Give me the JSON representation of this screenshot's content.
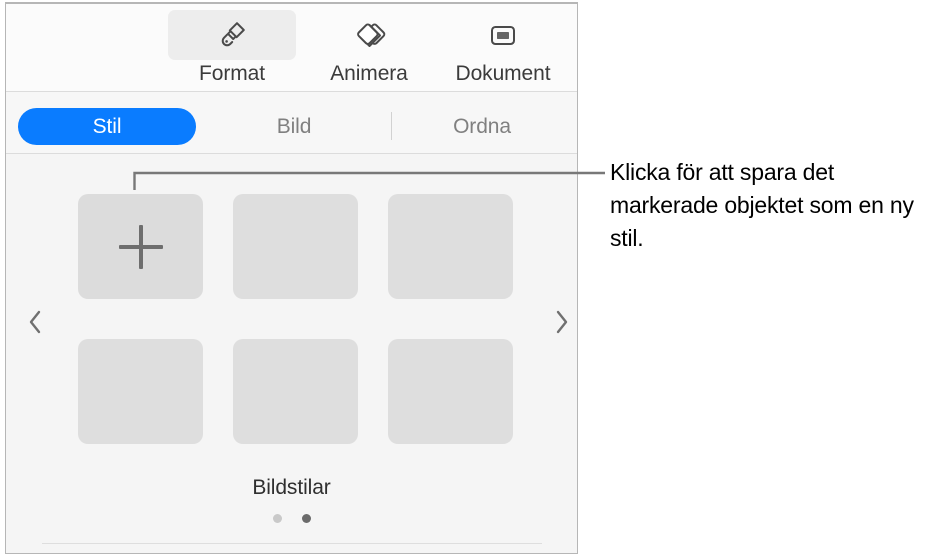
{
  "inspector": {
    "toolbar": {
      "buttons": [
        {
          "label": "Format",
          "icon": "paintbrush-icon",
          "selected": true
        },
        {
          "label": "Animera",
          "icon": "overlapping-diamonds-icon",
          "selected": false
        },
        {
          "label": "Dokument",
          "icon": "document-frame-icon",
          "selected": false
        }
      ]
    },
    "tabs": [
      {
        "label": "Stil",
        "selected": true
      },
      {
        "label": "Bild",
        "selected": false
      },
      {
        "label": "Ordna",
        "selected": false
      }
    ],
    "styles": {
      "section_label": "Bildstilar",
      "add_tile_icon": "plus-icon",
      "prev_icon": "chevron-left-icon",
      "next_icon": "chevron-right-icon",
      "tiles": [
        {
          "type": "add",
          "label": ""
        },
        {
          "type": "style",
          "label": ""
        },
        {
          "type": "style",
          "label": ""
        },
        {
          "type": "style",
          "label": ""
        },
        {
          "type": "style",
          "label": ""
        },
        {
          "type": "style",
          "label": ""
        }
      ],
      "page_dots": {
        "count": 2,
        "active_index": 1
      }
    }
  },
  "callout": {
    "text": "Klicka för att spara det markerade objektet som en ny stil.",
    "line_color": "#787878"
  },
  "colors": {
    "accent_blue": "#0a7cff",
    "panel_bg": "#f5f5f5",
    "toolbar_bg": "#fbfbfb",
    "tile_gray": "#dedede",
    "add_tile_gray": "#dcdcdc",
    "label_gray": "#808080",
    "dot_inactive": "#c9c9c9",
    "dot_active": "#6b6b6b"
  }
}
